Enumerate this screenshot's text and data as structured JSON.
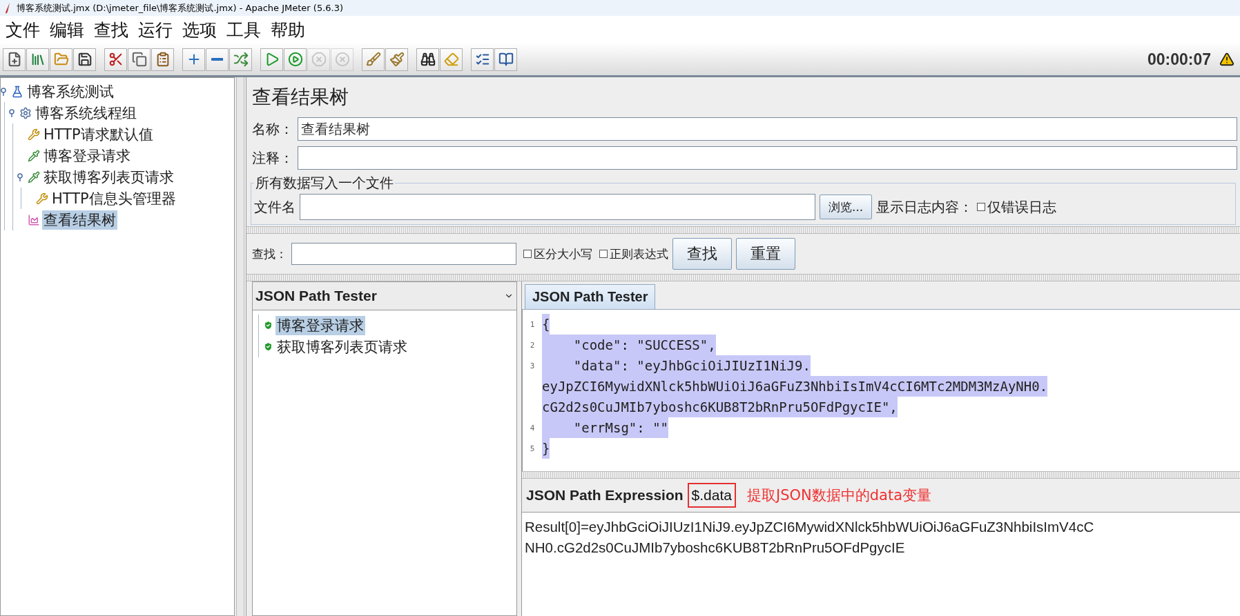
{
  "window": {
    "title": "博客系统测试.jmx (D:\\jmeter_file\\博客系统测试.jmx) - Apache JMeter (5.6.3)"
  },
  "menu": [
    "文件",
    "编辑",
    "查找",
    "运行",
    "选项",
    "工具",
    "帮助"
  ],
  "toolbar": [
    [
      {
        "kind": "new",
        "disabled": false
      },
      {
        "kind": "templates",
        "disabled": false
      },
      {
        "kind": "open",
        "disabled": false
      },
      {
        "kind": "save",
        "disabled": false
      }
    ],
    [
      {
        "kind": "cut",
        "disabled": false
      },
      {
        "kind": "copy",
        "disabled": false
      },
      {
        "kind": "paste",
        "disabled": false
      }
    ],
    [
      {
        "kind": "expand",
        "disabled": false
      },
      {
        "kind": "collapse",
        "disabled": false
      },
      {
        "kind": "toggle",
        "disabled": false
      }
    ],
    [
      {
        "kind": "start",
        "disabled": false
      },
      {
        "kind": "start-no-pause",
        "disabled": false
      },
      {
        "kind": "stop",
        "disabled": true
      },
      {
        "kind": "shutdown",
        "disabled": true
      }
    ],
    [
      {
        "kind": "clear",
        "disabled": false
      },
      {
        "kind": "clear-all",
        "disabled": false
      }
    ],
    [
      {
        "kind": "search",
        "disabled": false
      },
      {
        "kind": "reset",
        "disabled": false
      }
    ],
    [
      {
        "kind": "functions",
        "disabled": false
      },
      {
        "kind": "help",
        "disabled": false
      }
    ]
  ],
  "timer": "00:00:07",
  "tree": [
    {
      "label": "博客系统测试",
      "kind": "plan",
      "selected": false,
      "expanded": true,
      "children": [
        {
          "label": "博客系统线程组",
          "kind": "threads",
          "selected": false,
          "expanded": true,
          "children": [
            {
              "label": "HTTP请求默认值",
              "kind": "config",
              "selected": false
            },
            {
              "label": "博客登录请求",
              "kind": "sampler",
              "selected": false
            },
            {
              "label": "获取博客列表页请求",
              "kind": "sampler",
              "selected": false,
              "expanded": true,
              "children": [
                {
                  "label": "HTTP信息头管理器",
                  "kind": "config",
                  "selected": false
                }
              ]
            },
            {
              "label": "查看结果树",
              "kind": "listener",
              "selected": true
            }
          ]
        }
      ]
    }
  ],
  "panel": {
    "title": "查看结果树",
    "name_label": "名称：",
    "name_value": "查看结果树",
    "comment_label": "注释：",
    "file_group": "所有数据写入一个文件",
    "file_label": "文件名",
    "browse_button": "浏览...",
    "log_label": "显示日志内容：",
    "log_options": [
      {
        "label": "仅错误日志",
        "checked": false
      }
    ]
  },
  "search": {
    "label": "查找：",
    "options": [
      {
        "label": "区分大小写",
        "checked": false
      },
      {
        "label": "正则表达式",
        "checked": false
      }
    ],
    "buttons": [
      "查找",
      "重置"
    ]
  },
  "renderer": {
    "value": "JSON Path Tester"
  },
  "results": [
    {
      "label": "博客登录请求",
      "selected": true
    },
    {
      "label": "获取博客列表页请求",
      "selected": false
    }
  ],
  "tabs": [
    {
      "label": "JSON Path Tester",
      "selected": true
    }
  ],
  "editor": {
    "lines": [
      {
        "number": "1",
        "rows": [
          "{"
        ],
        "selected": true
      },
      {
        "number": "2",
        "rows": [
          "    \"code\": \"SUCCESS\","
        ],
        "selected": true
      },
      {
        "number": "3",
        "rows": [
          "    \"data\": \"eyJhbGciOiJIUzI1NiJ9.",
          "eyJpZCI6MywidXNlck5hbWUiOiJ6aGFuZ3NhbiIsImV4cCI6MTc2MDM3MzAyNH0.",
          "cG2d2s0CuJMIb7yboshc6KUB8T2bRnPru5OFdPgycIE\","
        ],
        "selected": true
      },
      {
        "number": "4",
        "rows": [
          "    \"errMsg\": \"\""
        ],
        "selected": true
      },
      {
        "number": "5",
        "rows": [
          "}"
        ],
        "selected": true
      }
    ]
  },
  "expression": {
    "label": "JSON Path Expression",
    "value": "$.data",
    "annotation": "提取JSON数据中的data变量"
  },
  "result": [
    "Result[0]=eyJhbGciOiJIUzI1NiJ9.eyJpZCI6MywidXNlck5hbWUiOiJ6aGFuZ3NhbiIsImV4cC",
    "NH0.cG2d2s0CuJMIb7yboshc6KUB8T2bRnPru5OFdPgycIE"
  ]
}
